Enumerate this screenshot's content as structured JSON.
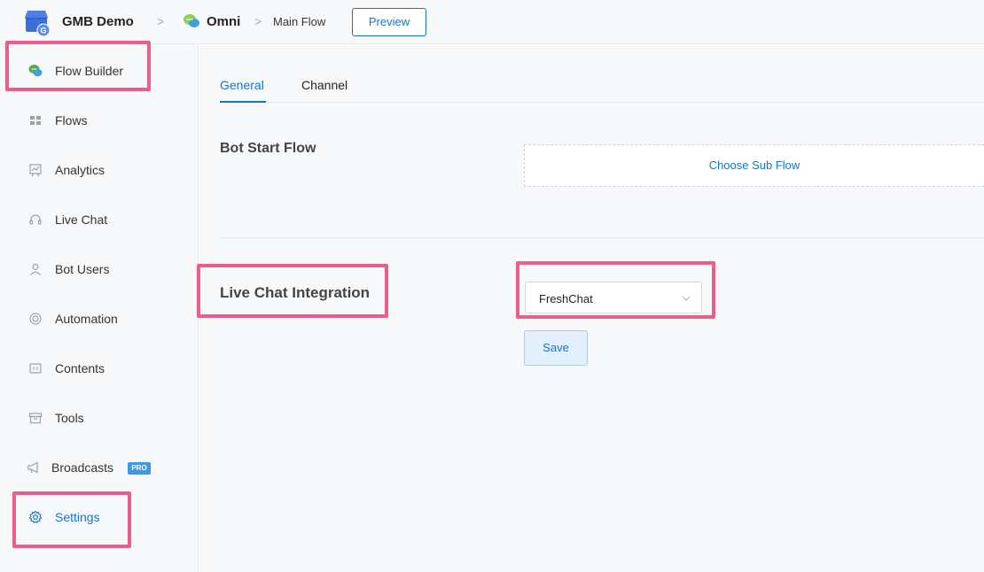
{
  "breadcrumb": {
    "workspace": "GMB Demo",
    "sep1": ">",
    "bot": "Omni",
    "sep2": ">",
    "flow": "Main Flow"
  },
  "header": {
    "preview_label": "Preview"
  },
  "sidebar": {
    "items": [
      {
        "label": "Flow Builder",
        "icon": "chat-bubble-icon",
        "active": false
      },
      {
        "label": "Flows",
        "icon": "grid-icon"
      },
      {
        "label": "Analytics",
        "icon": "chart-icon"
      },
      {
        "label": "Live Chat",
        "icon": "headset-icon"
      },
      {
        "label": "Bot Users",
        "icon": "user-icon"
      },
      {
        "label": "Automation",
        "icon": "lifebuoy-icon"
      },
      {
        "label": "Contents",
        "icon": "content-icon"
      },
      {
        "label": "Tools",
        "icon": "archive-icon"
      },
      {
        "label": "Broadcasts",
        "icon": "megaphone-icon",
        "badge": "PRO"
      },
      {
        "label": "Settings",
        "icon": "gear-icon",
        "active": true
      }
    ]
  },
  "tabs": [
    {
      "label": "General",
      "active": true
    },
    {
      "label": "Channel",
      "active": false
    }
  ],
  "general": {
    "bot_start_flow_title": "Bot Start Flow",
    "choose_sub_flow_label": "Choose Sub Flow",
    "live_chat_integration_title": "Live Chat Integration",
    "live_chat_select_value": "FreshChat",
    "save_label": "Save"
  },
  "colors": {
    "accent": "#1a74c4",
    "highlight": "#ec5d8e",
    "background": "#f7f8fa"
  }
}
